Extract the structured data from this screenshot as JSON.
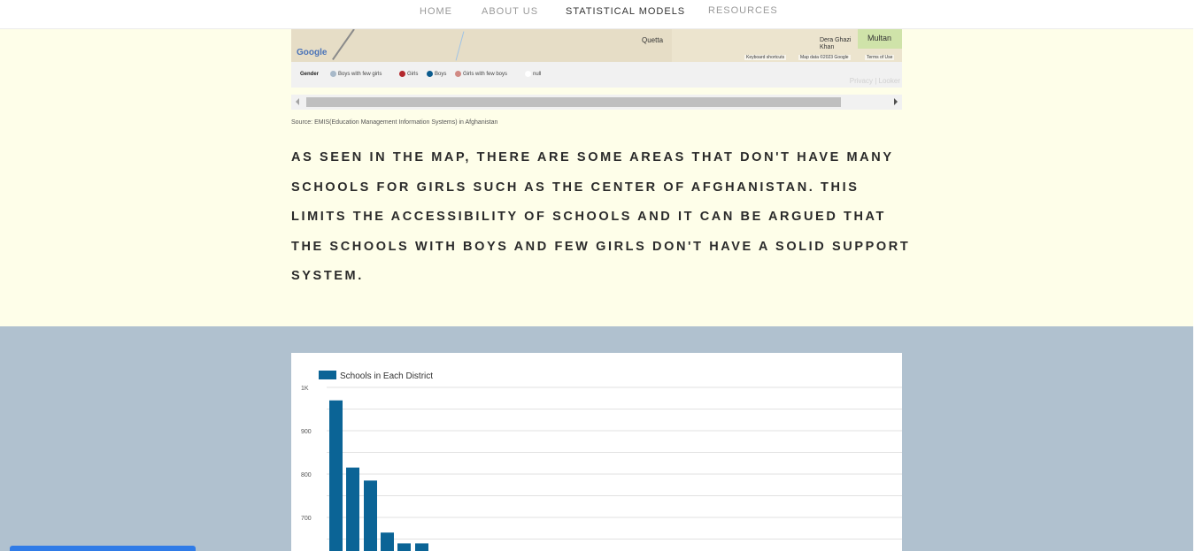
{
  "nav": {
    "items": [
      {
        "label": "HOME",
        "active": false
      },
      {
        "label": "ABOUT US",
        "active": false
      },
      {
        "label": "STATISTICAL MODELS",
        "active": true
      },
      {
        "label": "RESOURCES",
        "active": false
      }
    ]
  },
  "map": {
    "google_label": "Google",
    "cities": [
      "Quetta",
      "Dera Ghazi Khan",
      "Multan"
    ],
    "attribution": [
      "Keyboard shortcuts",
      "Map data ©2023 Google",
      "Terms of Use"
    ],
    "legend_title": "Gender",
    "legend": [
      {
        "label": "Boys with few girls",
        "color": "#a8b9c9"
      },
      {
        "label": "Girls",
        "color": "#b3282d"
      },
      {
        "label": "Boys",
        "color": "#0b5b8d"
      },
      {
        "label": "Girls with few boys",
        "color": "#d18a84"
      },
      {
        "label": "null",
        "color": "#ffffff"
      }
    ],
    "privacy": "Privacy",
    "looker": "Looker"
  },
  "source": "Source: EMIS(Education Management Information Systems) in Afghanistan",
  "paragraph": "As seen in the map, there are some areas that don't have many schools for girls such as the center of Afghanistan. This limits the accessibility of schools and it can be argued that the schools with boys and few girls don't have a solid support system.",
  "chart_data": {
    "type": "bar",
    "legend": [
      {
        "name": "Schools in Each District",
        "color": "#0b6496"
      }
    ],
    "y_ticks": [
      "1K",
      "900",
      "800",
      "700"
    ],
    "values": [
      970,
      815,
      785,
      665,
      640,
      640
    ],
    "ylim": [
      600,
      1000
    ],
    "grid": true
  },
  "colors": {
    "nav_active": "#333333",
    "nav_inactive": "#9a9a9a",
    "yellow_bg": "#fefee9",
    "blue_bg": "#b0c1cf",
    "bar": "#0b6496"
  }
}
